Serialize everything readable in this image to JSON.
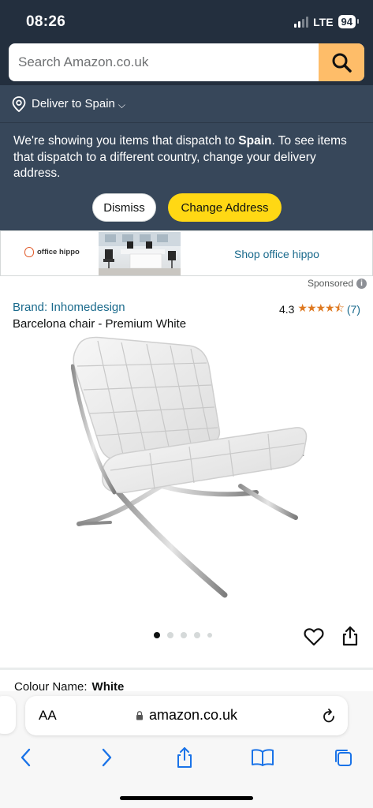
{
  "status_bar": {
    "time": "08:26",
    "network": "LTE",
    "battery": "94"
  },
  "search": {
    "placeholder": "Search Amazon.co.uk"
  },
  "deliver": {
    "label": "Deliver to Spain"
  },
  "banner": {
    "message_before": "We're showing you items that dispatch to ",
    "country": "Spain",
    "message_after": ". To see items that dispatch to a different country, change your delivery address.",
    "dismiss_label": "Dismiss",
    "change_label": "Change Address"
  },
  "ad": {
    "logo_text": "office hippo",
    "link_text": "Shop office hippo",
    "sponsored_label": "Sponsored"
  },
  "product": {
    "brand": "Brand: Inhomedesign",
    "rating": "4.3",
    "rating_count": "(7)",
    "stars": "★★★★⯪",
    "title": "Barcelona chair - Premium White",
    "image_count": 5,
    "active_image": 1,
    "colour_label": "Colour Name:",
    "colour_value": "White"
  },
  "browser": {
    "text_size_label": "AA",
    "url": "amazon.co.uk"
  },
  "colors": {
    "header": "#232f3e",
    "banner": "#37475a",
    "search_button": "#febd69",
    "primary_button": "#ffd814",
    "link": "#1a6a8c",
    "stars": "#de7921"
  },
  "icons": [
    "search-icon",
    "location-pin-icon",
    "chevron-down-icon",
    "info-icon",
    "heart-icon",
    "share-icon",
    "lock-icon",
    "reload-icon",
    "back-icon",
    "forward-icon",
    "safari-share-icon",
    "bookmarks-icon",
    "tabs-icon"
  ]
}
